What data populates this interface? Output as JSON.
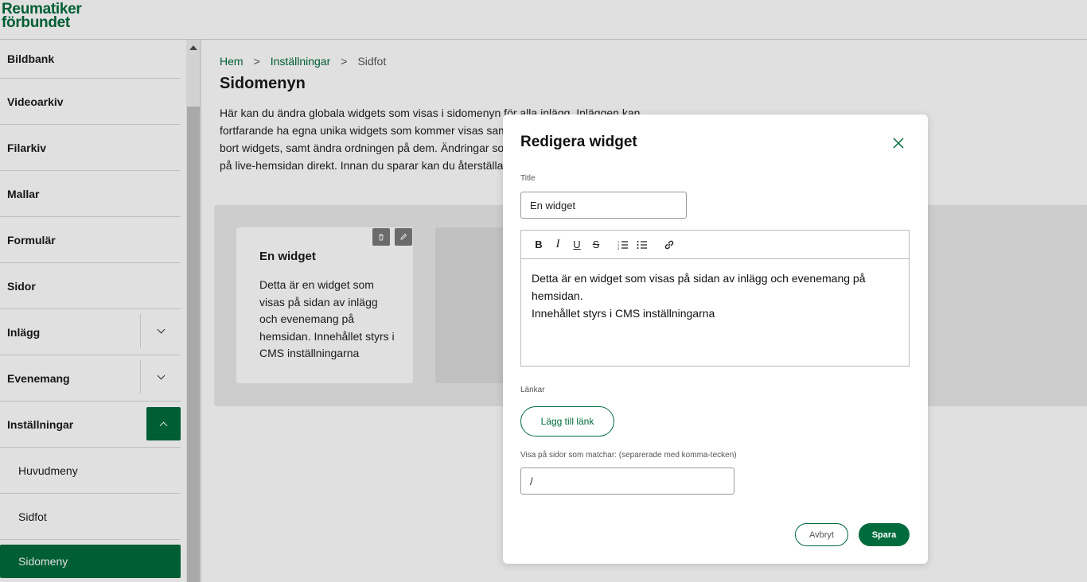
{
  "brand": {
    "line1": "Reumatiker",
    "line2": "förbundet",
    "color": "#006b3c"
  },
  "sidebar": {
    "items": [
      {
        "label": "Bildbank"
      },
      {
        "label": "Videoarkiv"
      },
      {
        "label": "Filarkiv"
      },
      {
        "label": "Mallar"
      },
      {
        "label": "Formulär"
      },
      {
        "label": "Sidor"
      },
      {
        "label": "Inlägg",
        "expandable": true
      },
      {
        "label": "Evenemang",
        "expandable": true
      },
      {
        "label": "Inställningar",
        "expandable": true,
        "expanded": true
      },
      {
        "label": "Huvudmeny",
        "sub": true
      },
      {
        "label": "Sidfot",
        "sub": true
      },
      {
        "label": "Sidomeny",
        "sub": true,
        "active": true
      }
    ]
  },
  "breadcrumb": {
    "home": "Hem",
    "settings": "Inställningar",
    "current": "Sidfot",
    "separator": ">"
  },
  "page": {
    "title": "Sidomenyn",
    "intro_lines": [
      "Här kan du ändra globala widgets som visas i sidomenyn för alla inlägg. Inläggen kan",
      "fortfarande ha egna unika widgets som kommer visas samtidigt",
      "bort widgets, samt ändra ordningen på dem. Ändringar som",
      "på live-hemsidan direkt. Innan du sparar kan du återställa ändringar"
    ]
  },
  "widget": {
    "title": "En widget",
    "body": "Detta är en widget som visas på sidan av inlägg och evenemang på hemsidan. Innehållet styrs i CMS inställningarna",
    "tools": [
      "chevron-left-icon",
      "chevron-right-icon",
      "trash-icon",
      "pencil-icon"
    ]
  },
  "modal": {
    "title": "Redigera widget",
    "title_label": "Title",
    "title_value": "En widget",
    "toolbar": [
      "bold-icon",
      "italic-icon",
      "underline-icon",
      "strikethrough-icon",
      "ordered-list-icon",
      "bullet-list-icon",
      "link-icon"
    ],
    "editor_lines": [
      "Detta är en widget som visas på sidan av inlägg och evenemang på hemsidan.",
      "Innehållet styrs i CMS inställningarna"
    ],
    "links_label": "Länkar",
    "add_link_label": "Lägg till länk",
    "match_label": "Visa på sidor som matchar: (separerade med komma-tecken)",
    "match_value": "/",
    "cancel_label": "Avbryt",
    "save_label": "Spara"
  }
}
